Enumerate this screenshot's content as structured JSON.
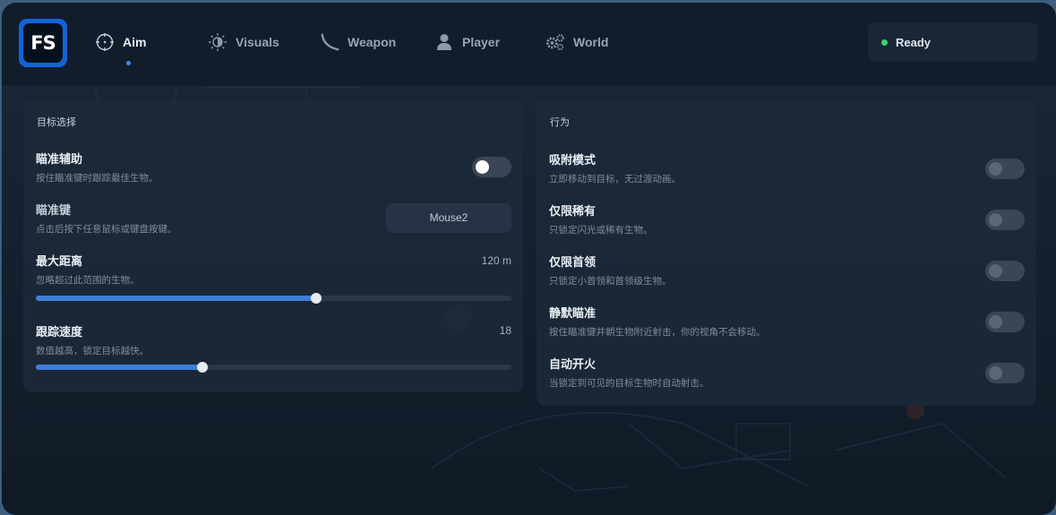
{
  "app": {
    "logo_text": "FS"
  },
  "nav": {
    "tabs": [
      {
        "label": "Aim",
        "icon": "crosshair-icon",
        "active": true
      },
      {
        "label": "Visuals",
        "icon": "sun-icon",
        "active": false
      },
      {
        "label": "Weapon",
        "icon": "bow-icon",
        "active": false
      },
      {
        "label": "Player",
        "icon": "user-icon",
        "active": false
      },
      {
        "label": "World",
        "icon": "gears-icon",
        "active": false
      }
    ]
  },
  "status": {
    "text": "Ready",
    "color": "#3ecf78"
  },
  "targeting": {
    "title": "目标选择",
    "aim_assist": {
      "title": "瞄准辅助",
      "subtitle": "按住瞄准键时跟踪最佳生物。",
      "enabled": true
    },
    "aim_key": {
      "title": "瞄准键",
      "subtitle": "点击后按下任意鼠标或键盘按键。",
      "value": "Mouse2"
    },
    "max_distance": {
      "title": "最大距离",
      "subtitle": "忽略超过此范围的生物。",
      "value_text": "120 m",
      "fraction": 0.59
    },
    "tracking_speed": {
      "title": "跟踪速度",
      "subtitle": "数值越高，锁定目标越快。",
      "value_text": "18",
      "fraction": 0.35
    }
  },
  "behavior": {
    "title": "行为",
    "items": [
      {
        "title": "吸附模式",
        "subtitle": "立即移动到目标，无过渡动画。",
        "enabled": false
      },
      {
        "title": "仅限稀有",
        "subtitle": "只锁定闪光或稀有生物。",
        "enabled": false
      },
      {
        "title": "仅限首领",
        "subtitle": "只锁定小首领和首领级生物。",
        "enabled": false
      },
      {
        "title": "静默瞄准",
        "subtitle": "按住瞄准键并朝生物附近射击，你的视角不会移动。",
        "enabled": false
      },
      {
        "title": "自动开火",
        "subtitle": "当锁定到可见的目标生物时自动射击。",
        "enabled": false
      }
    ]
  },
  "colors": {
    "accent": "#3e7fd6",
    "brand": "#1463d6"
  }
}
